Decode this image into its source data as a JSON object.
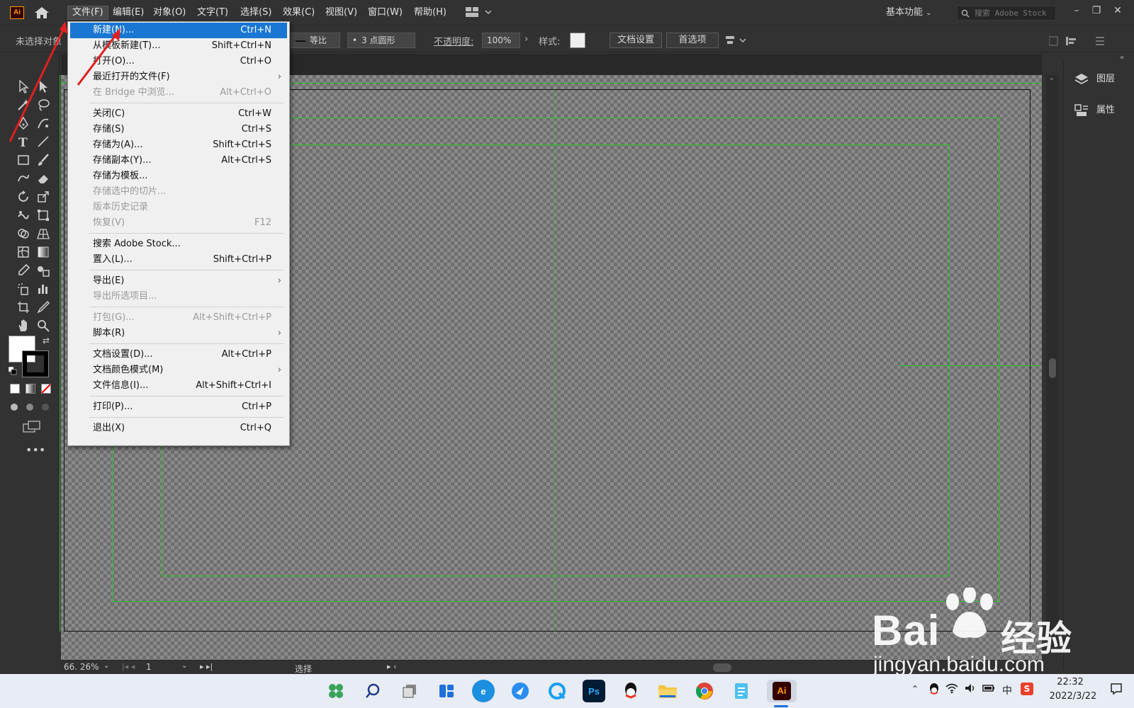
{
  "app": {
    "logo_text": "Ai",
    "menus": [
      "文件(F)",
      "编辑(E)",
      "对象(O)",
      "文字(T)",
      "选择(S)",
      "效果(C)",
      "视图(V)",
      "窗口(W)",
      "帮助(H)"
    ],
    "workspace": "基本功能",
    "search_placeholder": "搜索 Adobe Stock"
  },
  "controlbar": {
    "no_selection": "未选择对象",
    "stroke_profile": "等比",
    "brush": "3 点圆形",
    "opacity_label": "不透明度:",
    "opacity_value": "100%",
    "style_label": "样式:",
    "doc_setup": "文档设置",
    "preferences": "首选项"
  },
  "file_menu": {
    "items": [
      {
        "label": "新建(N)...",
        "shortcut": "Ctrl+N",
        "state": "highlighted"
      },
      {
        "label": "从模板新建(T)...",
        "shortcut": "Shift+Ctrl+N"
      },
      {
        "label": "打开(O)...",
        "shortcut": "Ctrl+O"
      },
      {
        "label": "最近打开的文件(F)",
        "submenu": true
      },
      {
        "label": "在 Bridge 中浏览...",
        "shortcut": "Alt+Ctrl+O",
        "state": "disabled"
      },
      {
        "label": "关闭(C)",
        "shortcut": "Ctrl+W"
      },
      {
        "label": "存储(S)",
        "shortcut": "Ctrl+S"
      },
      {
        "label": "存储为(A)...",
        "shortcut": "Shift+Ctrl+S"
      },
      {
        "label": "存储副本(Y)...",
        "shortcut": "Alt+Ctrl+S"
      },
      {
        "label": "存储为模板..."
      },
      {
        "label": "存储选中的切片...",
        "state": "disabled"
      },
      {
        "label": "版本历史记录",
        "state": "disabled"
      },
      {
        "label": "恢复(V)",
        "shortcut": "F12",
        "state": "disabled"
      },
      {
        "label": "搜索 Adobe Stock..."
      },
      {
        "label": "置入(L)...",
        "shortcut": "Shift+Ctrl+P"
      },
      {
        "label": "导出(E)",
        "submenu": true
      },
      {
        "label": "导出所选项目...",
        "state": "disabled"
      },
      {
        "label": "打包(G)...",
        "shortcut": "Alt+Shift+Ctrl+P",
        "state": "disabled"
      },
      {
        "label": "脚本(R)",
        "submenu": true
      },
      {
        "label": "文档设置(D)...",
        "shortcut": "Alt+Ctrl+P"
      },
      {
        "label": "文档颜色模式(M)",
        "submenu": true
      },
      {
        "label": "文件信息(I)...",
        "shortcut": "Alt+Shift+Ctrl+I"
      },
      {
        "label": "打印(P)...",
        "shortcut": "Ctrl+P"
      },
      {
        "label": "退出(X)",
        "shortcut": "Ctrl+Q"
      }
    ],
    "submenu_arrow": "›"
  },
  "right_panel": {
    "layers": "图层",
    "properties": "属性"
  },
  "statusbar": {
    "zoom": "66. 26%",
    "artboard": "1",
    "tool_status": "选择"
  },
  "taskbar": {
    "time": "22:32",
    "date": "2022/3/22",
    "ime": "中"
  },
  "watermark": {
    "brand": "Bai",
    "brand2": "经验",
    "url": "jingyan.baidu.com"
  }
}
